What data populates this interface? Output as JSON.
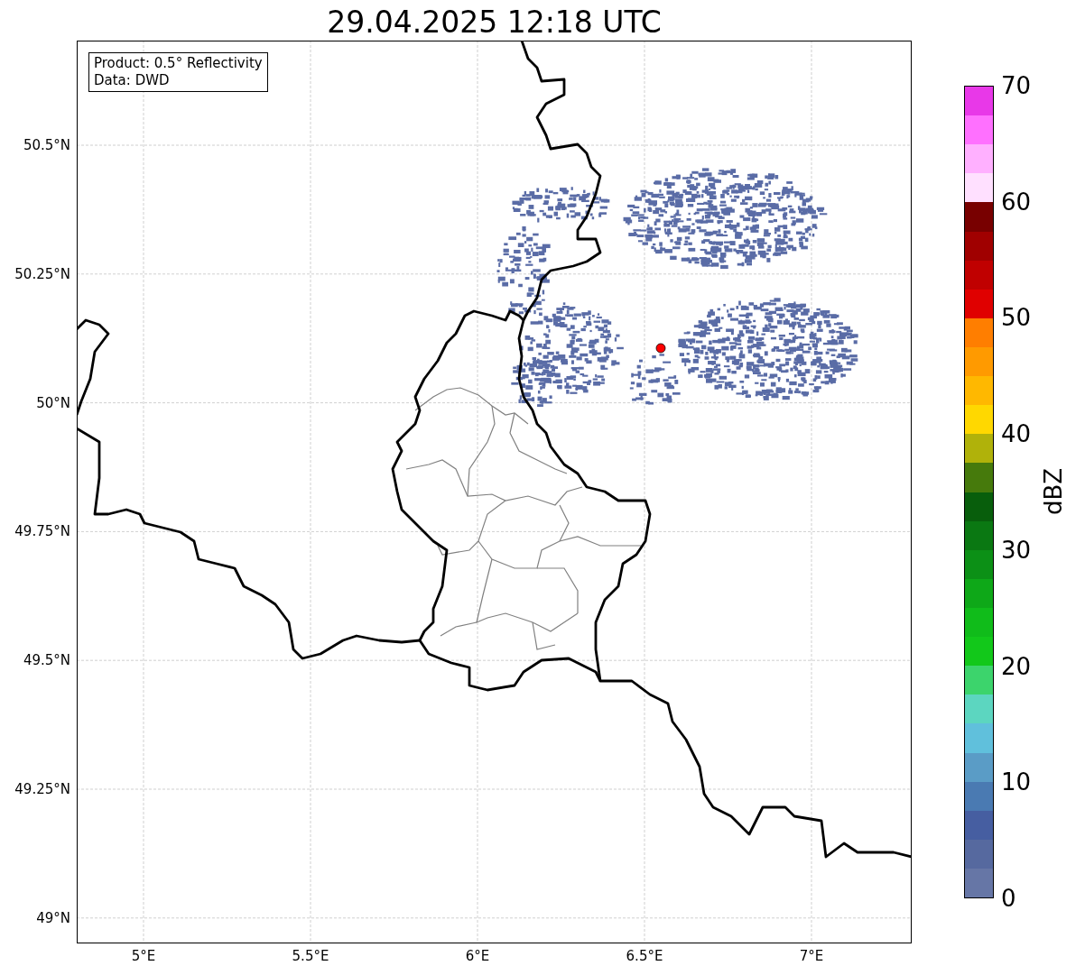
{
  "title": "29.04.2025 12:18 UTC",
  "info_box": {
    "lines": [
      "Product: 0.5° Reflectivity",
      "Data: DWD"
    ]
  },
  "map": {
    "x_ticks": [
      "5°E",
      "5.5°E",
      "6°E",
      "6.5°E",
      "7°E"
    ],
    "y_ticks": [
      "50.5°N",
      "50.25°N",
      "50°N",
      "49.75°N",
      "49.5°N",
      "49.25°N",
      "49°N"
    ]
  },
  "colorbar": {
    "label": "dBZ",
    "ticks": [
      "70",
      "60",
      "50",
      "40",
      "30",
      "20",
      "10",
      "0"
    ],
    "bands": [
      {
        "color": "#e838e8"
      },
      {
        "color": "#ff70ff"
      },
      {
        "color": "#ffb0ff"
      },
      {
        "color": "#ffe0ff"
      },
      {
        "color": "#780000"
      },
      {
        "color": "#a00000"
      },
      {
        "color": "#c00000"
      },
      {
        "color": "#e00000"
      },
      {
        "color": "#ff7e00"
      },
      {
        "color": "#ff9a00"
      },
      {
        "color": "#ffb800"
      },
      {
        "color": "#ffd800"
      },
      {
        "color": "#b0b20a"
      },
      {
        "color": "#467a0c"
      },
      {
        "color": "#085e0c"
      },
      {
        "color": "#0a7812"
      },
      {
        "color": "#0c9016"
      },
      {
        "color": "#0ea818"
      },
      {
        "color": "#10bc1a"
      },
      {
        "color": "#12c81a"
      },
      {
        "color": "#3cd46c"
      },
      {
        "color": "#5cd6c0"
      },
      {
        "color": "#60c0dc"
      },
      {
        "color": "#5a9cc6"
      },
      {
        "color": "#4a7ab2"
      },
      {
        "color": "#465ea1"
      },
      {
        "color": "#56699f"
      },
      {
        "color": "#6676a6"
      }
    ]
  }
}
